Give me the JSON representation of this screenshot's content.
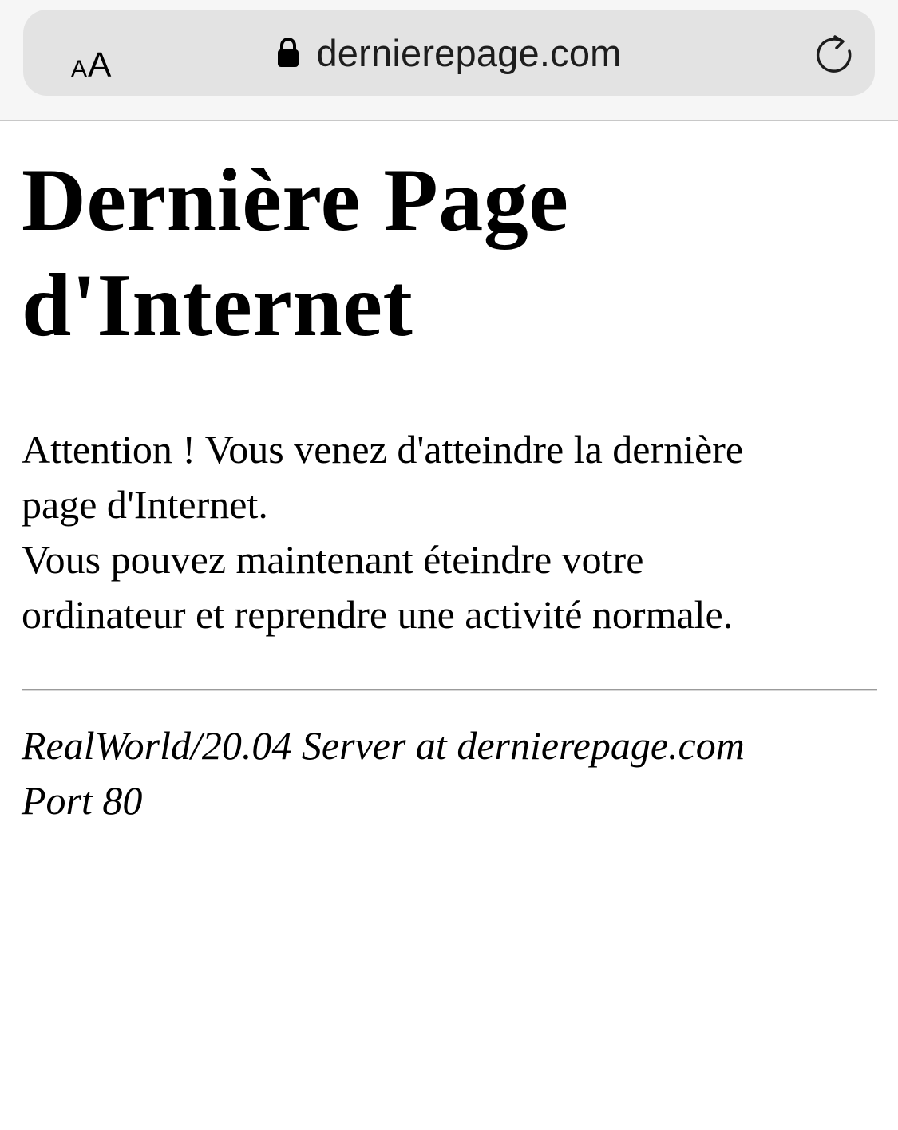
{
  "browser": {
    "text_size_small": "A",
    "text_size_large": "A",
    "url": "dernierepage.com",
    "icons": {
      "lock": "lock-icon",
      "reload": "reload-icon"
    }
  },
  "page": {
    "title_line1": "Dernière Page",
    "title_line2": "d'Internet",
    "message_line1": "Attention ! Vous venez d'atteindre la dernière",
    "message_line2": "page d'Internet.",
    "message_line3": "Vous pouvez maintenant éteindre votre",
    "message_line4": "ordinateur et reprendre une activité normale.",
    "server_signature_line1": "RealWorld/20.04 Server at dernierepage.com",
    "server_signature_line2": "Port 80"
  }
}
